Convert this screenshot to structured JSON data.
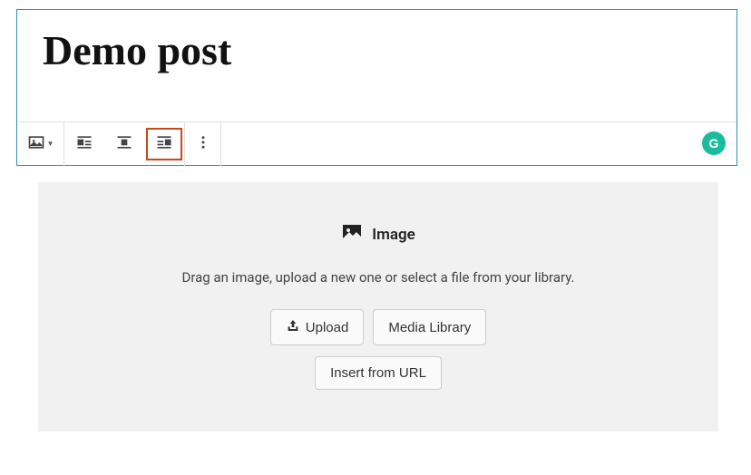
{
  "post": {
    "title": "Demo post"
  },
  "toolbar": {
    "block_type": "image"
  },
  "placeholder": {
    "heading": "Image",
    "instructions": "Drag an image, upload a new one or select a file from your library.",
    "upload_label": "Upload",
    "media_library_label": "Media Library",
    "insert_url_label": "Insert from URL"
  }
}
